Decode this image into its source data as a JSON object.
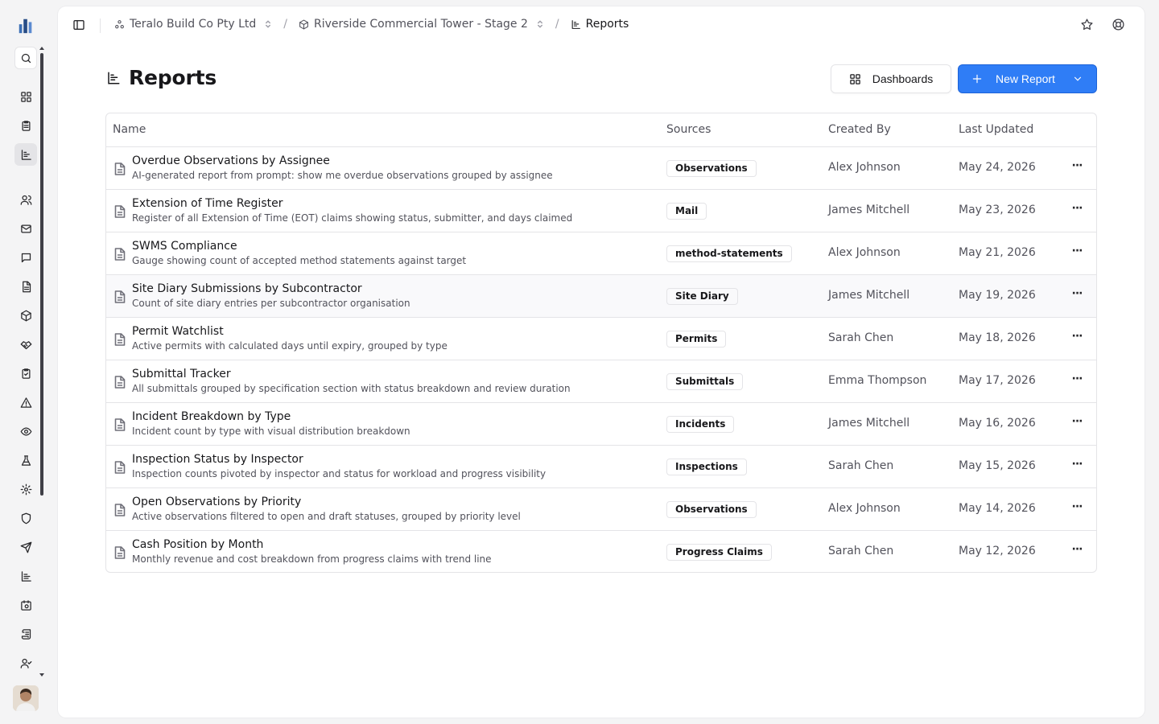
{
  "breadcrumb": {
    "org": "Teralo Build Co Pty Ltd",
    "project": "Riverside Commercial Tower - Stage 2",
    "current": "Reports",
    "separator": "/"
  },
  "page": {
    "title": "Reports",
    "dashboards_label": "Dashboards",
    "new_report_label": "New Report"
  },
  "table": {
    "columns": {
      "name": "Name",
      "sources": "Sources",
      "created_by": "Created By",
      "last_updated": "Last Updated"
    },
    "rows": [
      {
        "title": "Overdue Observations by Assignee",
        "desc": "AI-generated report from prompt: show me overdue observations grouped by assignee",
        "source": "Observations",
        "by": "Alex Johnson",
        "date": "May 24, 2026",
        "more": "···"
      },
      {
        "title": "Extension of Time Register",
        "desc": "Register of all Extension of Time (EOT) claims showing status, submitter, and days claimed",
        "source": "Mail",
        "by": "James Mitchell",
        "date": "May 23, 2026",
        "more": "···"
      },
      {
        "title": "SWMS Compliance",
        "desc": "Gauge showing count of accepted method statements against target",
        "source": "method-statements",
        "by": "Alex Johnson",
        "date": "May 21, 2026",
        "more": "···"
      },
      {
        "title": "Site Diary Submissions by Subcontractor",
        "desc": "Count of site diary entries per subcontractor organisation",
        "source": "Site Diary",
        "by": "James Mitchell",
        "date": "May 19, 2026",
        "more": "···"
      },
      {
        "title": "Permit Watchlist",
        "desc": "Active permits with calculated days until expiry, grouped by type",
        "source": "Permits",
        "by": "Sarah Chen",
        "date": "May 18, 2026",
        "more": "···"
      },
      {
        "title": "Submittal Tracker",
        "desc": "All submittals grouped by specification section with status breakdown and review duration",
        "source": "Submittals",
        "by": "Emma Thompson",
        "date": "May 17, 2026",
        "more": "···"
      },
      {
        "title": "Incident Breakdown by Type",
        "desc": "Incident count by type with visual distribution breakdown",
        "source": "Incidents",
        "by": "James Mitchell",
        "date": "May 16, 2026",
        "more": "···"
      },
      {
        "title": "Inspection Status by Inspector",
        "desc": "Inspection counts pivoted by inspector and status for workload and progress visibility",
        "source": "Inspections",
        "by": "Sarah Chen",
        "date": "May 15, 2026",
        "more": "···"
      },
      {
        "title": "Open Observations by Priority",
        "desc": "Active observations filtered to open and draft statuses, grouped by priority level",
        "source": "Observations",
        "by": "Alex Johnson",
        "date": "May 14, 2026",
        "more": "···"
      },
      {
        "title": "Cash Position by Month",
        "desc": "Monthly revenue and cost breakdown from progress claims with trend line",
        "source": "Progress Claims",
        "by": "Sarah Chen",
        "date": "May 12, 2026",
        "more": "···"
      }
    ]
  },
  "colors": {
    "primary": "#2f7df6",
    "border": "#e4e4e7",
    "muted_text": "#52525b"
  }
}
